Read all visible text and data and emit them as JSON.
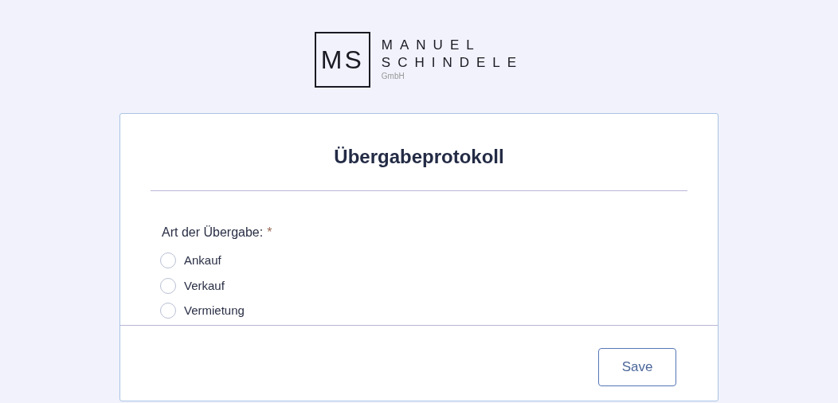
{
  "logo": {
    "monogram": "MS",
    "line_1": "MANUEL",
    "line_2": "SCHINDELE",
    "line_3": "GmbH"
  },
  "form": {
    "title": "Übergabeprotokoll",
    "field_label": "Art der Übergabe:",
    "required_mark": "*",
    "options": [
      {
        "label": "Ankauf",
        "selected": false
      },
      {
        "label": "Verkauf",
        "selected": false
      },
      {
        "label": "Vermietung",
        "selected": false
      }
    ],
    "save_button": "Save"
  }
}
